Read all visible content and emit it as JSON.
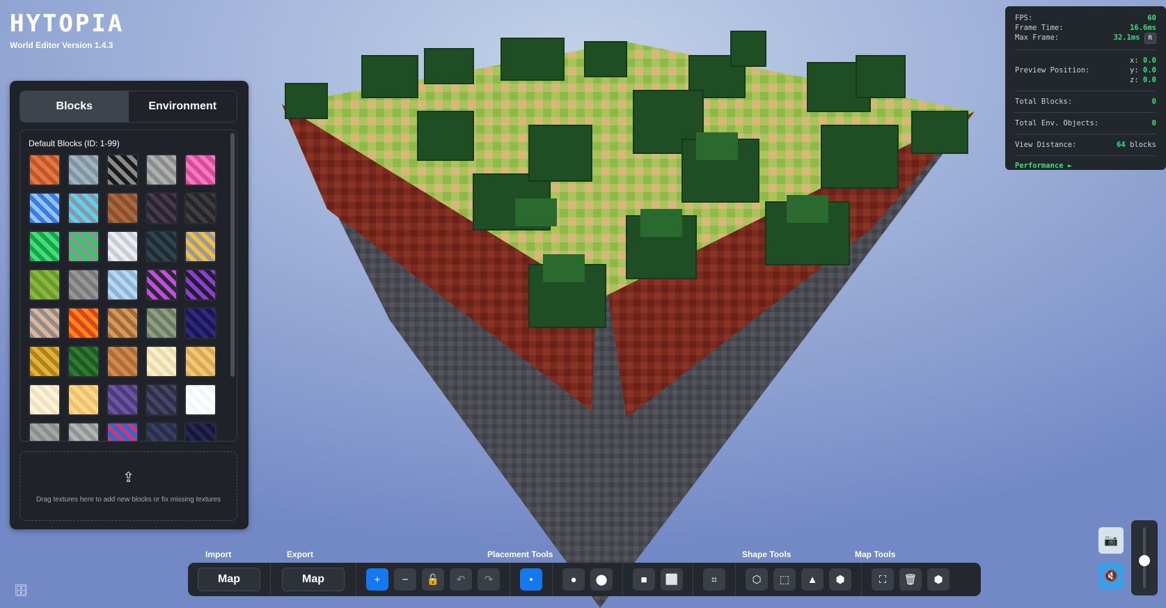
{
  "logo": {
    "title": "HYTOPIA",
    "version": "World Editor Version 1.4.3"
  },
  "block_panel": {
    "tabs": [
      "Blocks",
      "Environment"
    ],
    "active_tab": "Blocks",
    "heading": "Default Blocks (ID: 1-99)",
    "drop_text": "Drag textures here to add new blocks or fix missing textures",
    "tiles": [
      {
        "name": "bricks",
        "c1": "#c4552a",
        "c2": "#e07a45"
      },
      {
        "name": "andesite",
        "c1": "#7f95a3",
        "c2": "#a1b3bf"
      },
      {
        "name": "coal-ore",
        "c1": "#8a8a8a",
        "c2": "#1a1a1a"
      },
      {
        "name": "cobblestone",
        "c1": "#8c8c8c",
        "c2": "#b0b0b0"
      },
      {
        "name": "pink-block",
        "c1": "#d94a9b",
        "c2": "#f07bbf"
      },
      {
        "name": "blue-tile",
        "c1": "#3b79e3",
        "c2": "#8ec4ff"
      },
      {
        "name": "diamond-ore",
        "c1": "#8d97a1",
        "c2": "#5ad2f4"
      },
      {
        "name": "dirt",
        "c1": "#8b4f2c",
        "c2": "#a96a42"
      },
      {
        "name": "dark-block",
        "c1": "#2a2230",
        "c2": "#463a4d"
      },
      {
        "name": "deepslate",
        "c1": "#262428",
        "c2": "#403d42"
      },
      {
        "name": "emerald-block",
        "c1": "#17a44a",
        "c2": "#40e07b"
      },
      {
        "name": "emerald-ore",
        "c1": "#8d939a",
        "c2": "#2fcf5f"
      },
      {
        "name": "snow-stone",
        "c1": "#c9cdd2",
        "c2": "#ecedef"
      },
      {
        "name": "glass",
        "c1": "#1d2c33",
        "c2": "#2f4650"
      },
      {
        "name": "gold-ore",
        "c1": "#9a9a9a",
        "c2": "#f0c040"
      },
      {
        "name": "grass",
        "c1": "#6b9a2b",
        "c2": "#88b840"
      },
      {
        "name": "gravel",
        "c1": "#7a7a7a",
        "c2": "#969696"
      },
      {
        "name": "ice",
        "c1": "#8fb5d6",
        "c2": "#b9d7ee"
      },
      {
        "name": "amethyst-vein",
        "c1": "#2a2634",
        "c2": "#c04fe0"
      },
      {
        "name": "purple-vein",
        "c1": "#201d2c",
        "c2": "#8a3fd0"
      },
      {
        "name": "iron-ore",
        "c1": "#8f8d8a",
        "c2": "#e0b49b"
      },
      {
        "name": "lava",
        "c1": "#e0421a",
        "c2": "#ff8a1a"
      },
      {
        "name": "log-top",
        "c1": "#a56a3a",
        "c2": "#d49a5e"
      },
      {
        "name": "mossy-cobble",
        "c1": "#6d7a6a",
        "c2": "#8fa07e"
      },
      {
        "name": "obsidian",
        "c1": "#1b1650",
        "c2": "#2f2a80"
      },
      {
        "name": "gold-swirl",
        "c1": "#b08418",
        "c2": "#e0b43a"
      },
      {
        "name": "leaves",
        "c1": "#1d5a22",
        "c2": "#2f7a33"
      },
      {
        "name": "planks",
        "c1": "#b06c38",
        "c2": "#d08a4c"
      },
      {
        "name": "sand-light",
        "c1": "#e9dca8",
        "c2": "#f7efcc"
      },
      {
        "name": "sand",
        "c1": "#dba954",
        "c2": "#f0c878"
      },
      {
        "name": "sandstone-light",
        "c1": "#efe3bd",
        "c2": "#fbf3da"
      },
      {
        "name": "sandstone",
        "c1": "#f0c06a",
        "c2": "#f8d88e"
      },
      {
        "name": "purple-stone",
        "c1": "#4c3a7e",
        "c2": "#6a55a0"
      },
      {
        "name": "slate",
        "c1": "#2e2e45",
        "c2": "#45456a"
      },
      {
        "name": "snow",
        "c1": "#f4f5f6",
        "c2": "#ffffff"
      },
      {
        "name": "stone",
        "c1": "#8d8d8d",
        "c2": "#a6a6a6"
      },
      {
        "name": "stone-2",
        "c1": "#939393",
        "c2": "#b3b3b3"
      },
      {
        "name": "blue-pink",
        "c1": "#d2347a",
        "c2": "#2a6ad0"
      },
      {
        "name": "navy-stone",
        "c1": "#2a2e4a",
        "c2": "#3a3f62"
      },
      {
        "name": "dark-navy",
        "c1": "#16163a",
        "c2": "#262650"
      }
    ]
  },
  "stats": {
    "fps_label": "FPS:",
    "fps": "60",
    "frame_time_label": "Frame Time:",
    "frame_time": "16.6ms",
    "max_frame_label": "Max Frame:",
    "max_frame": "32.1ms",
    "reset": "R",
    "preview_label": "Preview Position:",
    "x_label": "x:",
    "x": "0.0",
    "y_label": "y:",
    "y": "0.0",
    "z_label": "z:",
    "z": "0.0",
    "total_blocks_label": "Total Blocks:",
    "total_blocks": "0",
    "total_env_label": "Total Env. Objects:",
    "total_env": "0",
    "view_distance_label": "View Distance:",
    "view_distance": "64",
    "view_distance_unit": "blocks",
    "performance": "Performance ►"
  },
  "toolbar": {
    "import_label": "Import",
    "export_label": "Export",
    "placement_label": "Placement Tools",
    "shape_label": "Shape Tools",
    "map_label": "Map Tools",
    "import_button": "Map",
    "export_button": "Map"
  },
  "icons": {
    "add": "+",
    "remove": "−",
    "unlock": "🔓",
    "undo": "↶",
    "redo": "↷",
    "single": "•",
    "small-brush": "●",
    "large-brush": "⬤",
    "small-square": "■",
    "large-square": "⬜",
    "select": "⌗",
    "cube": "⬡",
    "wall": "⬚",
    "terrain": "▲",
    "spheres": "⬢",
    "fullscreen": "⛶",
    "trash": "🗑",
    "cluster": "⬢",
    "camera": "📷",
    "mute": "🔇",
    "database": "🗄",
    "upload": "⇪"
  },
  "slider": {
    "value": 0.55
  }
}
